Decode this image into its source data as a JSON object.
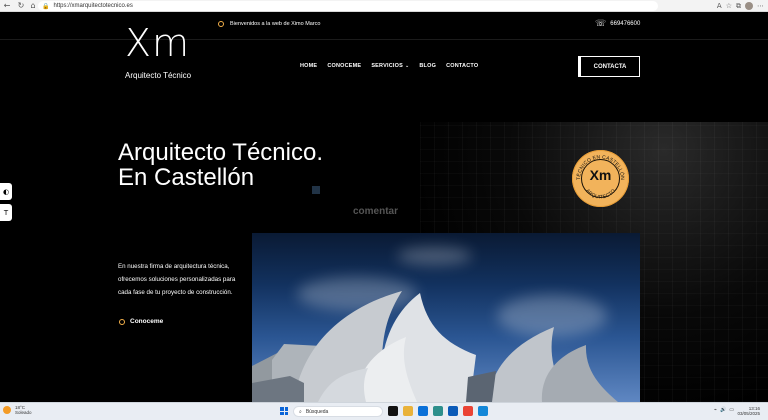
{
  "browser": {
    "url": "https://xmarquitectotecnico.es",
    "back_icon": "←",
    "refresh_icon": "↻",
    "home_icon": "⌂",
    "lock_icon": "🔒",
    "read_aloud_icon": "A",
    "favorite_icon": "☆",
    "collections_icon": "⧉",
    "extensions_icon": "⋯"
  },
  "header": {
    "logo": "Xm",
    "logo_subtitle": "Arquitecto Técnico",
    "welcome_text": "Bienvenidos a la web de Ximo Marco",
    "phone_number": "669476600",
    "phone_icon": "☏",
    "menu": [
      {
        "label": "HOME"
      },
      {
        "label": "CONOCEME"
      },
      {
        "label": "SERVICIOS",
        "has_dropdown": true
      },
      {
        "label": "BLOG"
      },
      {
        "label": "CONTACTO"
      }
    ],
    "menu_chevron": "⌄",
    "cta_label": "CONTACTA"
  },
  "hero": {
    "title_line1": "Arquitecto Técnico.",
    "title_line2": "En Castellón",
    "badge_monogram": "Xm",
    "badge_top": "TÉCNICO EN CASTELLÓN",
    "badge_bottom": "ARQUITECTO",
    "comment": "comentar",
    "intro": "En nuestra firma de arquitectura técnica, ofrecemos soluciones personalizadas para cada fase de tu proyecto de construcción.",
    "link_label": "Conoceme"
  },
  "tools": {
    "contrast_icon": "◐",
    "text_size_icon": "T"
  },
  "taskbar": {
    "temperature": "18°C",
    "weather_condition": "Soleado",
    "search_placeholder": "Búsqueda",
    "search_icon": "⌕",
    "time": "13:16",
    "date": "03/05/2025",
    "wifi_icon": "⌁",
    "volume_icon": "🔊",
    "battery_icon": "▭",
    "colors": {
      "accent": "#f2b35b",
      "taskbar": "#e9edf3"
    }
  }
}
